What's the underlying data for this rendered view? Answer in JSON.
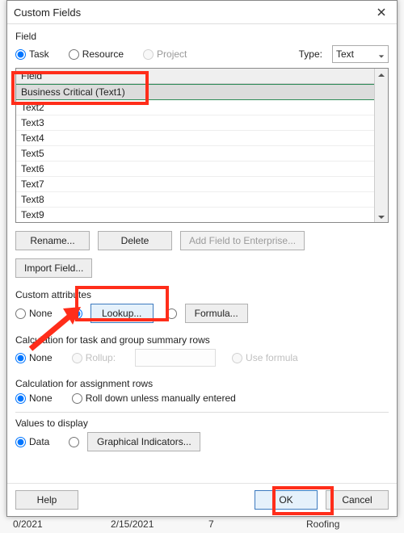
{
  "window": {
    "title": "Custom Fields"
  },
  "field_section": {
    "label": "Field",
    "task_label": "Task",
    "resource_label": "Resource",
    "project_label": "Project",
    "type_label": "Type:",
    "type_value": "Text"
  },
  "field_list": {
    "header": "Field",
    "items": [
      "Business Critical (Text1)",
      "Text2",
      "Text3",
      "Text4",
      "Text5",
      "Text6",
      "Text7",
      "Text8",
      "Text9"
    ]
  },
  "field_buttons": {
    "rename": "Rename...",
    "delete": "Delete",
    "add_enterprise": "Add Field to Enterprise...",
    "import": "Import Field..."
  },
  "custom_attributes": {
    "label": "Custom attributes",
    "none": "None",
    "lookup": "Lookup...",
    "formula": "Formula..."
  },
  "calc_task": {
    "label": "Calculation for task and group summary rows",
    "none": "None",
    "rollup": "Rollup:",
    "use_formula": "Use formula"
  },
  "calc_assign": {
    "label": "Calculation for assignment rows",
    "none": "None",
    "rolldown": "Roll down unless manually entered"
  },
  "values_display": {
    "label": "Values to display",
    "data": "Data",
    "graphical": "Graphical Indicators..."
  },
  "footer": {
    "help": "Help",
    "ok": "OK",
    "cancel": "Cancel"
  },
  "background": {
    "c1": "0/2021",
    "c2": "2/15/2021",
    "c3": "7",
    "c4": "Roofing"
  }
}
